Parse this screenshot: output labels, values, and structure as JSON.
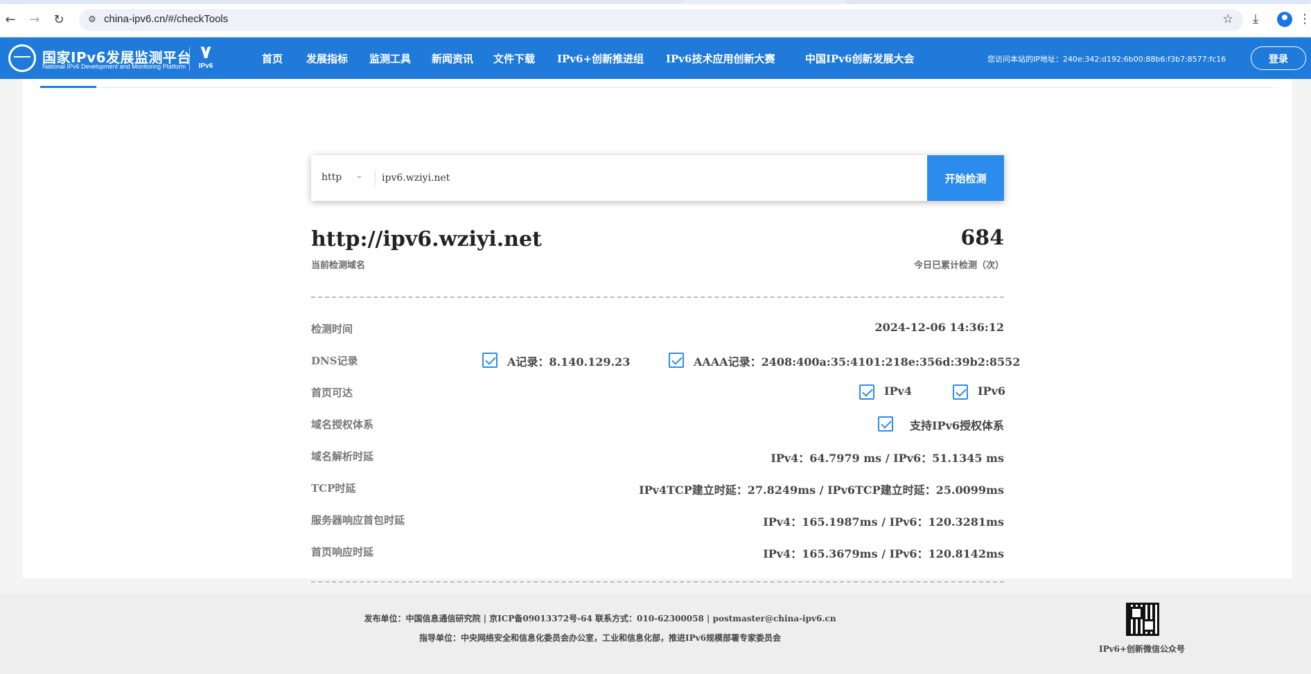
{
  "browser": {
    "url": "china-ipv6.cn/#/checkTools"
  },
  "header": {
    "logo_cn": "国家IPv6发展监测平台",
    "logo_en": "National IPv6 Development and Monitoring Platform",
    "ipv6_mark": "IPv6",
    "nav": [
      "首页",
      "发展指标",
      "监测工具",
      "新闻资讯",
      "文件下载",
      "IPv6+创新推进组",
      "IPv6技术应用创新大赛",
      "中国IPv6创新发展大会"
    ],
    "visitor_ip": "您访问本站的IP地址：240e:342:d192:6b00:88b6:f3b7:8577:fc16",
    "login": "登录"
  },
  "search": {
    "protocol": "http",
    "domain_value": "ipv6.wziyi.net",
    "start_button": "开始检测"
  },
  "result": {
    "domain": "http://ipv6.wziyi.net",
    "domain_label": "当前检测域名",
    "count": "684",
    "count_label": "今日已累计检测（次）",
    "rows": {
      "time": {
        "label": "检测时间",
        "value": "2024-12-06 14:36:12"
      },
      "dns": {
        "label": "DNS记录",
        "a": "A记录：8.140.129.23",
        "aaaa": "AAAA记录：2408:400a:35:4101:218e:356d:39b2:8552"
      },
      "reach": {
        "label": "首页可达",
        "ipv4": "IPv4",
        "ipv6": "IPv6"
      },
      "auth": {
        "label": "域名授权体系",
        "value": "支持IPv6授权体系"
      },
      "dns_latency": {
        "label": "域名解析时延",
        "value": "IPv4：64.7979 ms / IPv6：51.1345 ms"
      },
      "tcp": {
        "label": "TCP时延",
        "value": "IPv4TCP建立时延：27.8249ms / IPv6TCP建立时延：25.0099ms"
      },
      "first_packet": {
        "label": "服务器响应首包时延",
        "value": "IPv4：165.1987ms / IPv6：120.3281ms"
      },
      "page_response": {
        "label": "首页响应时延",
        "value": "IPv4：165.3679ms / IPv6：120.8142ms"
      }
    },
    "checks": {
      "dns_a": true,
      "dns_aaaa": true,
      "reach_ipv4": true,
      "reach_ipv6": true,
      "auth": true
    }
  },
  "footer": {
    "line1": "发布单位：中国信息通信研究院 | 京ICP备09013372号-64 联系方式：010-62300058 | postmaster@china-ipv6.cn",
    "line2": "指导单位：中央网络安全和信息化委员会办公室，工业和信息化部，推进IPv6规模部署专家委员会",
    "qr_label": "IPv6+创新微信公众号"
  },
  "colors": {
    "brand_blue": "#1f7ad9",
    "button_blue": "#2b8ced"
  }
}
